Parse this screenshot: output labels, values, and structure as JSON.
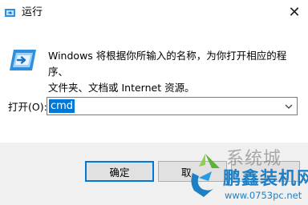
{
  "window": {
    "title": "运行",
    "close_glyph": "✕"
  },
  "description": {
    "line1": "Windows 将根据你所输入的名称，为你打开相应的程序、",
    "line2": "文件夹、文档或 Internet 资源。"
  },
  "open_field": {
    "label": "打开(O):",
    "value": "cmd"
  },
  "buttons": {
    "ok": "确定",
    "cancel": "取"
  },
  "watermark": {
    "top_text": "系统城",
    "brand": "鹏鑫装机网",
    "url": "www.0753pc.net"
  },
  "colors": {
    "accent": "#0078d7",
    "button_bg": "#e1e1e1",
    "footer_bg": "#f0f0f0",
    "brand_blue": "#1f7fc4"
  },
  "icons": [
    "run-app-icon",
    "close-icon",
    "run-icon",
    "chevron-down-icon",
    "watermark-logo-icon"
  ]
}
